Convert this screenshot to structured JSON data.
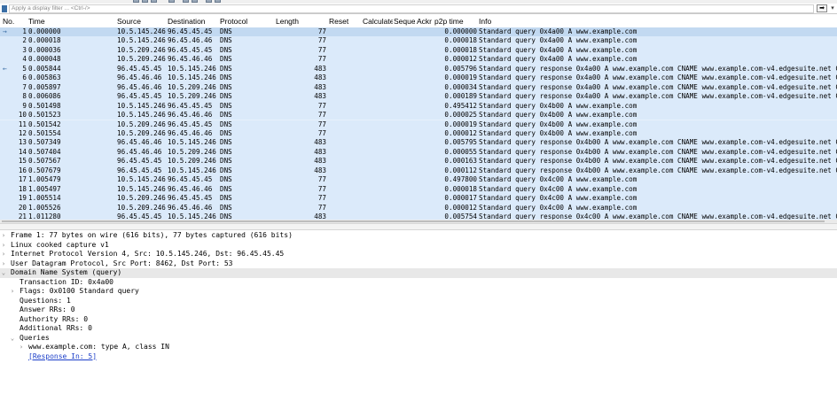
{
  "filter": {
    "placeholder": "Apply a display filter ... <Ctrl-/>",
    "apply_glyph": "➡",
    "dropdown_glyph": "▾"
  },
  "columns": [
    "No.",
    "Time",
    "Source",
    "Destination",
    "Protocol",
    "Length",
    "Reset",
    "Calculate",
    "Seque",
    "Ackr",
    "p2p time",
    "Info"
  ],
  "packets": [
    {
      "no": "1",
      "time": "0.000000",
      "src": "10.5.145.246",
      "dst": "96.45.45.45",
      "proto": "DNS",
      "len": "77",
      "p2p": "0.000000",
      "info": "Standard query 0x4a00 A www.example.com",
      "rel": "→"
    },
    {
      "no": "2",
      "time": "0.000018",
      "src": "10.5.145.246",
      "dst": "96.45.46.46",
      "proto": "DNS",
      "len": "77",
      "p2p": "0.000018",
      "info": "Standard query 0x4a00 A www.example.com",
      "rel": ""
    },
    {
      "no": "3",
      "time": "0.000036",
      "src": "10.5.209.246",
      "dst": "96.45.45.45",
      "proto": "DNS",
      "len": "77",
      "p2p": "0.000018",
      "info": "Standard query 0x4a00 A www.example.com",
      "rel": ""
    },
    {
      "no": "4",
      "time": "0.000048",
      "src": "10.5.209.246",
      "dst": "96.45.46.46",
      "proto": "DNS",
      "len": "77",
      "p2p": "0.000012",
      "info": "Standard query 0x4a00 A www.example.com",
      "rel": ""
    },
    {
      "no": "5",
      "time": "0.005844",
      "src": "96.45.45.45",
      "dst": "10.5.145.246",
      "proto": "DNS",
      "len": "483",
      "p2p": "0.005796",
      "info": "Standard query response 0x4a00 A www.example.com CNAME www.example.com-v4.edgesuite.net CN",
      "rel": "←"
    },
    {
      "no": "6",
      "time": "0.005863",
      "src": "96.45.46.46",
      "dst": "10.5.145.246",
      "proto": "DNS",
      "len": "483",
      "p2p": "0.000019",
      "info": "Standard query response 0x4a00 A www.example.com CNAME www.example.com-v4.edgesuite.net CN",
      "rel": ""
    },
    {
      "no": "7",
      "time": "0.005897",
      "src": "96.45.46.46",
      "dst": "10.5.209.246",
      "proto": "DNS",
      "len": "483",
      "p2p": "0.000034",
      "info": "Standard query response 0x4a00 A www.example.com CNAME www.example.com-v4.edgesuite.net CN",
      "rel": ""
    },
    {
      "no": "8",
      "time": "0.006086",
      "src": "96.45.45.45",
      "dst": "10.5.209.246",
      "proto": "DNS",
      "len": "483",
      "p2p": "0.000189",
      "info": "Standard query response 0x4a00 A www.example.com CNAME www.example.com-v4.edgesuite.net CN",
      "rel": ""
    },
    {
      "no": "9",
      "time": "0.501498",
      "src": "10.5.145.246",
      "dst": "96.45.45.45",
      "proto": "DNS",
      "len": "77",
      "p2p": "0.495412",
      "info": "Standard query 0x4b00 A www.example.com",
      "rel": ""
    },
    {
      "no": "10",
      "time": "0.501523",
      "src": "10.5.145.246",
      "dst": "96.45.46.46",
      "proto": "DNS",
      "len": "77",
      "p2p": "0.000025",
      "info": "Standard query 0x4b00 A www.example.com",
      "rel": ""
    },
    {
      "no": "11",
      "time": "0.501542",
      "src": "10.5.209.246",
      "dst": "96.45.45.45",
      "proto": "DNS",
      "len": "77",
      "p2p": "0.000019",
      "info": "Standard query 0x4b00 A www.example.com",
      "rel": ""
    },
    {
      "no": "12",
      "time": "0.501554",
      "src": "10.5.209.246",
      "dst": "96.45.46.46",
      "proto": "DNS",
      "len": "77",
      "p2p": "0.000012",
      "info": "Standard query 0x4b00 A www.example.com",
      "rel": ""
    },
    {
      "no": "13",
      "time": "0.507349",
      "src": "96.45.46.46",
      "dst": "10.5.145.246",
      "proto": "DNS",
      "len": "483",
      "p2p": "0.005795",
      "info": "Standard query response 0x4b00 A www.example.com CNAME www.example.com-v4.edgesuite.net CN",
      "rel": ""
    },
    {
      "no": "14",
      "time": "0.507404",
      "src": "96.45.46.46",
      "dst": "10.5.209.246",
      "proto": "DNS",
      "len": "483",
      "p2p": "0.000055",
      "info": "Standard query response 0x4b00 A www.example.com CNAME www.example.com-v4.edgesuite.net CN",
      "rel": ""
    },
    {
      "no": "15",
      "time": "0.507567",
      "src": "96.45.45.45",
      "dst": "10.5.209.246",
      "proto": "DNS",
      "len": "483",
      "p2p": "0.000163",
      "info": "Standard query response 0x4b00 A www.example.com CNAME www.example.com-v4.edgesuite.net CN",
      "rel": ""
    },
    {
      "no": "16",
      "time": "0.507679",
      "src": "96.45.45.45",
      "dst": "10.5.145.246",
      "proto": "DNS",
      "len": "483",
      "p2p": "0.000112",
      "info": "Standard query response 0x4b00 A www.example.com CNAME www.example.com-v4.edgesuite.net CN",
      "rel": ""
    },
    {
      "no": "17",
      "time": "1.005479",
      "src": "10.5.145.246",
      "dst": "96.45.45.45",
      "proto": "DNS",
      "len": "77",
      "p2p": "0.497800",
      "info": "Standard query 0x4c00 A www.example.com",
      "rel": ""
    },
    {
      "no": "18",
      "time": "1.005497",
      "src": "10.5.145.246",
      "dst": "96.45.46.46",
      "proto": "DNS",
      "len": "77",
      "p2p": "0.000018",
      "info": "Standard query 0x4c00 A www.example.com",
      "rel": ""
    },
    {
      "no": "19",
      "time": "1.005514",
      "src": "10.5.209.246",
      "dst": "96.45.45.45",
      "proto": "DNS",
      "len": "77",
      "p2p": "0.000017",
      "info": "Standard query 0x4c00 A www.example.com",
      "rel": ""
    },
    {
      "no": "20",
      "time": "1.005526",
      "src": "10.5.209.246",
      "dst": "96.45.46.46",
      "proto": "DNS",
      "len": "77",
      "p2p": "0.000012",
      "info": "Standard query 0x4c00 A www.example.com",
      "rel": ""
    },
    {
      "no": "21",
      "time": "1.011280",
      "src": "96.45.45.45",
      "dst": "10.5.145.246",
      "proto": "DNS",
      "len": "483",
      "p2p": "0.005754",
      "info": "Standard query response 0x4c00 A www.example.com CNAME www.example.com-v4.edgesuite.net CN",
      "rel": ""
    }
  ],
  "details": [
    {
      "arrow": "›",
      "text": "Frame 1: 77 bytes on wire (616 bits), 77 bytes captured (616 bits)",
      "link": false
    },
    {
      "arrow": "›",
      "text": "Linux cooked capture v1",
      "link": false
    },
    {
      "arrow": "›",
      "text": "Internet Protocol Version 4, Src: 10.5.145.246, Dst: 96.45.45.45",
      "link": false
    },
    {
      "arrow": "›",
      "text": "User Datagram Protocol, Src Port: 8462, Dst Port: 53",
      "link": false
    },
    {
      "arrow": "⌄",
      "text": "Domain Name System (query)",
      "link": false
    },
    {
      "arrow": "",
      "text": "Transaction ID: 0x4a00",
      "link": false
    },
    {
      "arrow": "›",
      "text": "Flags: 0x0100 Standard query",
      "link": false
    },
    {
      "arrow": "",
      "text": "Questions: 1",
      "link": false
    },
    {
      "arrow": "",
      "text": "Answer RRs: 0",
      "link": false
    },
    {
      "arrow": "",
      "text": "Authority RRs: 0",
      "link": false
    },
    {
      "arrow": "",
      "text": "Additional RRs: 0",
      "link": false
    },
    {
      "arrow": "⌄",
      "text": "Queries",
      "link": false
    },
    {
      "arrow": "›",
      "text": "www.example.com: type A, class IN",
      "link": false
    },
    {
      "arrow": "",
      "text": "[Response In: 5]",
      "link": true
    }
  ],
  "colors": {
    "row_bg": "#dbeafa",
    "selected_row_bg": "#c2d9f1",
    "link": "#1a3dc8"
  },
  "icons": {
    "filter_bookmark": "bookmark-icon",
    "apply": "arrow-right-icon"
  }
}
